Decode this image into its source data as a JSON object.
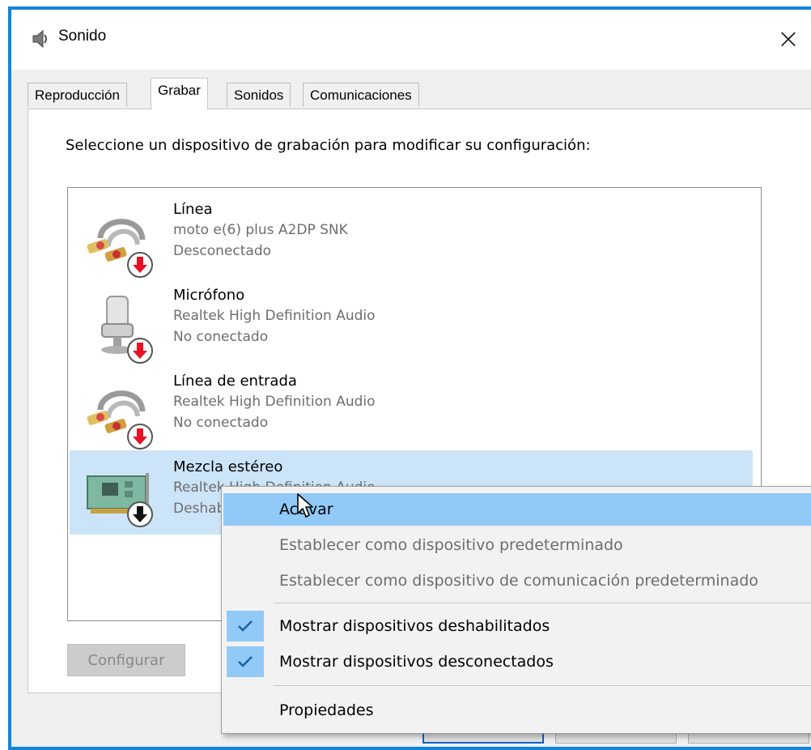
{
  "window": {
    "title": "Sonido",
    "close_glyph": "×",
    "icon": "speaker-icon"
  },
  "tabs": [
    {
      "label": "Reproducción",
      "active": false
    },
    {
      "label": "Grabar",
      "active": true
    },
    {
      "label": "Sonidos",
      "active": false
    },
    {
      "label": "Comunicaciones",
      "active": false
    }
  ],
  "instruction": "Seleccione un dispositivo de grabación para modificar su configuración:",
  "devices": [
    {
      "name": "Línea",
      "sub": "moto e(6) plus A2DP SNK",
      "status": "Desconectado",
      "icon": "rca-cable-icon",
      "badge": "red-down-arrow-icon",
      "selected": false
    },
    {
      "name": "Micrófono",
      "sub": "Realtek High Definition Audio",
      "status": "No conectado",
      "icon": "microphone-icon",
      "badge": "red-down-arrow-icon",
      "selected": false
    },
    {
      "name": "Línea de entrada",
      "sub": "Realtek High Definition Audio",
      "status": "No conectado",
      "icon": "rca-cable-icon",
      "badge": "red-down-arrow-icon",
      "selected": false
    },
    {
      "name": "Mezcla estéreo",
      "sub": "Realtek High Definition Audio",
      "status": "Deshabilitado",
      "icon": "sound-card-icon",
      "badge": "black-down-arrow-icon",
      "selected": true
    }
  ],
  "buttons": {
    "configure": "Configurar"
  },
  "context_menu": {
    "items": [
      {
        "label": "Activar",
        "enabled": true,
        "highlighted": true,
        "checked": false
      },
      {
        "label": "Establecer como dispositivo predeterminado",
        "enabled": false,
        "highlighted": false,
        "checked": false
      },
      {
        "label": "Establecer como dispositivo de comunicación predeterminado",
        "enabled": false,
        "highlighted": false,
        "checked": false
      },
      {
        "label": "Mostrar dispositivos deshabilitados",
        "enabled": true,
        "highlighted": false,
        "checked": true
      },
      {
        "label": "Mostrar dispositivos desconectados",
        "enabled": true,
        "highlighted": false,
        "checked": true
      },
      {
        "label": "Propiedades",
        "enabled": true,
        "highlighted": false,
        "checked": false
      }
    ],
    "check_glyph": "✔"
  },
  "colors": {
    "window_border": "#1185d8",
    "selection": "#cce4f7",
    "menu_highlight": "#91c9f7",
    "disabled_text": "#6d6d6d",
    "badge_red": "#e81123"
  }
}
